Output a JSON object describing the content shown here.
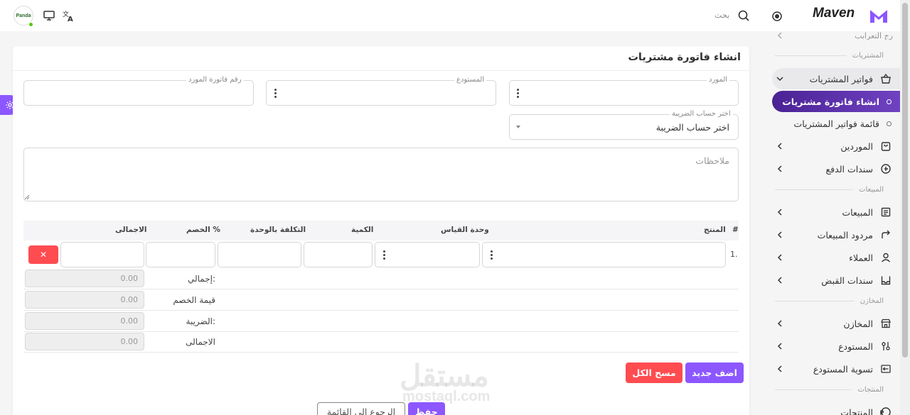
{
  "header": {
    "brand": "Maven",
    "search_label": "بحث",
    "avatar_text": "Panda"
  },
  "sidebar": {
    "top_partial": "رج التعرابب",
    "sections": {
      "purchases": "المشتريات",
      "sales": "المبيعات",
      "stores": "المخازن",
      "products": "المنتجات"
    },
    "items": {
      "purchase_invoices": "فواتير المشتريات",
      "create_invoice": "انشاء فاتورة مشتريات",
      "invoice_list": "قائمة فواتير المشتريات",
      "suppliers": "الموردين",
      "payment_vouchers": "سندات الدفع",
      "sales": "المبيعات",
      "sales_returns": "مردود المبيعات",
      "customers": "العملاء",
      "receipt_vouchers": "سندات القبض",
      "stores": "المخازن",
      "warehouse": "المستودع",
      "warehouse_adjustment": "تسوية المستودع",
      "products": "المنتجات"
    }
  },
  "form": {
    "title": "انشاء فاتورة مشتريات",
    "supplier_label": "المورد",
    "warehouse_label": "المستودع",
    "supplier_invoice_label": "رقم فاتورة المورد",
    "tax_label": "اختر حساب الضريبة",
    "tax_value": "اختر حساب الضريبة",
    "notes_placeholder": "ملاحظات"
  },
  "table": {
    "headers": {
      "num": "#",
      "product": "المنتج",
      "unit": "وحدة القياس",
      "qty": "الكمية",
      "unit_cost": "التكلفة بالوحدة",
      "discount": "الخصم %",
      "total": "الاجمالى"
    },
    "row_number": "1.",
    "delete_symbol": "✕"
  },
  "summary": {
    "subtotal_label": "إجمالي:",
    "subtotal_value": "0.00",
    "discount_label": "قيمة الخصم",
    "discount_value": "0.00",
    "tax_label": "الضريبة:",
    "tax_value": "0.00",
    "total_label": "الاجمالى",
    "total_value": "0.00"
  },
  "actions": {
    "add_new": "اضف جديد",
    "clear_all": "مسح الكل",
    "save": "حفظ",
    "back_to_list": "الرجوع الى القائمة"
  },
  "watermark": {
    "arabic": "مستقل",
    "latin": "mostaql.com"
  },
  "colors": {
    "primary": "#8c57ff",
    "primary_dark": "#4a2294",
    "danger": "#ff4c51"
  }
}
